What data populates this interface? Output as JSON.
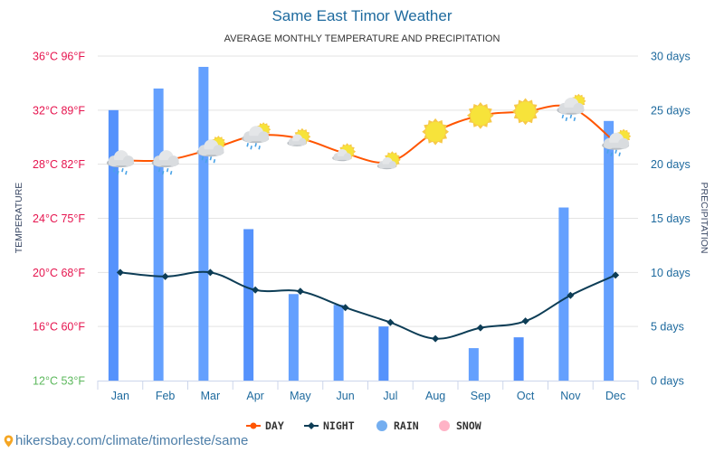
{
  "chart_data": {
    "type": "bar+line",
    "title": "Same East Timor Weather",
    "subtitle": "AVERAGE MONTHLY TEMPERATURE AND PRECIPITATION",
    "categories": [
      "Jan",
      "Feb",
      "Mar",
      "Apr",
      "May",
      "Jun",
      "Jul",
      "Aug",
      "Sep",
      "Oct",
      "Nov",
      "Dec"
    ],
    "series": [
      {
        "name": "DAY",
        "type": "line",
        "axis": "left",
        "unit": "°C",
        "color": "#ff5500",
        "values": [
          28.3,
          28.3,
          29.1,
          30.1,
          29.9,
          28.8,
          28.2,
          30.4,
          31.6,
          31.9,
          32.2,
          29.6
        ]
      },
      {
        "name": "NIGHT",
        "type": "line",
        "axis": "left",
        "unit": "°C",
        "color": "#0d3d56",
        "values": [
          20.0,
          19.7,
          20.0,
          18.7,
          18.6,
          17.4,
          16.3,
          15.1,
          15.9,
          16.4,
          18.3,
          19.8
        ]
      },
      {
        "name": "RAIN",
        "type": "bar",
        "axis": "right",
        "unit": "days",
        "color": "#5b9bfd",
        "values": [
          25,
          27,
          29,
          14,
          8,
          7,
          5,
          0,
          3,
          4,
          16,
          24
        ]
      },
      {
        "name": "SNOW",
        "type": "bar",
        "axis": "right",
        "unit": "days",
        "color": "#ffb3c6",
        "values": [
          0,
          0,
          0,
          0,
          0,
          0,
          0,
          0,
          0,
          0,
          0,
          0
        ]
      }
    ],
    "weather_icons": [
      "cloud-rain",
      "cloud-rain",
      "cloud-sun-rain",
      "cloud-sun-rain",
      "sun-cloud",
      "sun-cloud",
      "sun-cloud",
      "sun",
      "sun",
      "sun",
      "cloud-sun-rain",
      "cloud-sun-rain"
    ],
    "ylabel_left": "TEMPERATURE",
    "ylabel_right": "PRECIPITATION",
    "ylim_left": [
      12,
      36
    ],
    "ylim_right": [
      0,
      30
    ],
    "yticks_left": [
      "36°C 96°F",
      "32°C 89°F",
      "28°C 82°F",
      "24°C 75°F",
      "20°C 68°F",
      "16°C 60°F",
      "12°C 53°F"
    ],
    "yticks_right": [
      "30 days",
      "25 days",
      "20 days",
      "15 days",
      "10 days",
      "5 days",
      "0 days"
    ],
    "grid": true,
    "legend_position": "bottom-center",
    "legend": [
      {
        "label": "DAY",
        "color": "#ff5500",
        "marker": "line-dot"
      },
      {
        "label": "NIGHT",
        "color": "#0d3d56",
        "marker": "line-diamond"
      },
      {
        "label": "RAIN",
        "color": "#74aef0",
        "marker": "circle"
      },
      {
        "label": "SNOW",
        "color": "#ffb3c6",
        "marker": "circle"
      }
    ]
  },
  "source": {
    "text": "hikersbay.com/climate/timorleste/same",
    "icon": "location-pin-icon"
  }
}
